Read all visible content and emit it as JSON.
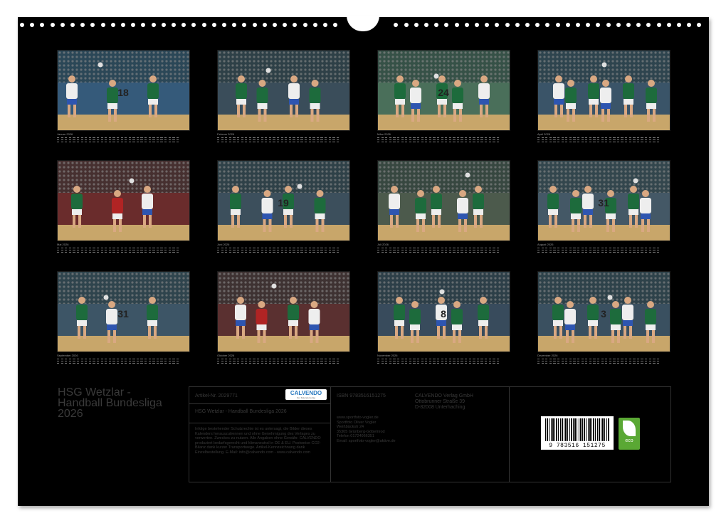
{
  "calendar": {
    "title": "HSG Wetzlar - Handball Bundesliga 2026",
    "title_lines": [
      "HSG Wetzlar -",
      "Handball Bundesliga",
      "2026"
    ],
    "months": [
      {
        "label": "Januar 2026",
        "jersey": "18",
        "bg": "#355a7a"
      },
      {
        "label": "Februar 2026",
        "jersey": "",
        "bg": "#3a4d5a"
      },
      {
        "label": "März 2026",
        "jersey": "24",
        "bg": "#4a6f5a"
      },
      {
        "label": "April 2026",
        "jersey": "",
        "bg": "#3a5468"
      },
      {
        "label": "Mai 2026",
        "jersey": "",
        "bg": "#6a2c2c"
      },
      {
        "label": "Juni 2026",
        "jersey": "19",
        "bg": "#3c4f5c"
      },
      {
        "label": "Juli 2026",
        "jersey": "",
        "bg": "#4c5a4c"
      },
      {
        "label": "August 2026",
        "jersey": "31",
        "bg": "#445866"
      },
      {
        "label": "September 2026",
        "jersey": "31",
        "bg": "#3d5566"
      },
      {
        "label": "Oktober 2026",
        "jersey": "",
        "bg": "#5a3030"
      },
      {
        "label": "November 2026",
        "jersey": "8",
        "bg": "#384b5c"
      },
      {
        "label": "Dezember 2026",
        "jersey": "3",
        "bg": "#3a5060"
      }
    ],
    "colors": {
      "green": "#1d6b3c",
      "white": "#eeeeee",
      "court": "#c8a66a",
      "red": "#b02424",
      "blue": "#2e55b0"
    }
  },
  "info": {
    "article": "Artikel-Nr. 2029771",
    "logo": "CALVENDO",
    "logo_sub": "Der Kalenderverlag",
    "product_title": "HSG Wetzlar - Handball Bundesliga 2026",
    "legal": "Infolge bestehender Schutzrechte ist es untersagt, die Bilder dieses Kalenders herauszutrennen und ohne Genehmigung des Verlages zu verwerten. Zweckes zu nutzen. Alle Angaben ohne Gewähr. CALVENDO produziert bedarfsgerecht und klimaneutral in DE & EU. Postweise CO2-Bilanz dank kurzer Transportwege. Artikel-Kennzeichnung dank Einzelbestellung. E-Mail: info@calvendo.com - www.calvendo.com",
    "isbn": "ISBN 9783516151275",
    "publisher": "CALVENDO Verlag GmbH",
    "street": "Ottobrunner Straße 39",
    "city": "D-82008 Unterhaching",
    "photographer": "www.sportfoto-vogler.de\nSportfoto Oliver Vogler\nWeißbäckstr 24\n35305 Grünberg-Göbelnrod\nTelefon 01724066351\nEmail: sportfoto-vogler@aktive.de",
    "barcode_number": "9 783516 151275",
    "eco_label": "eco"
  }
}
